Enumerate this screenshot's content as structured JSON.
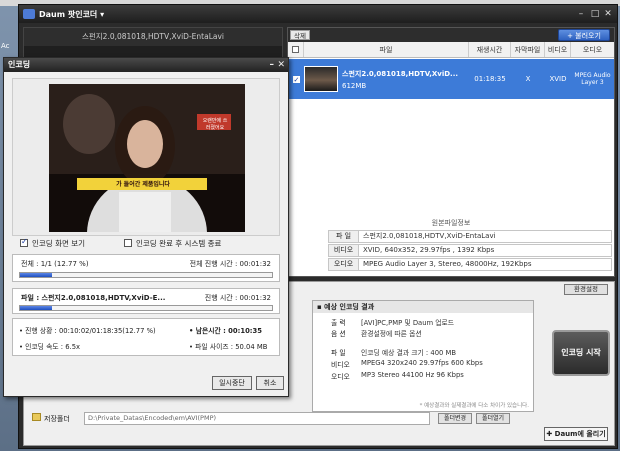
{
  "desktop": {
    "side_label": "Ac"
  },
  "main": {
    "title": "Daum 팟인코더 ▾",
    "left_header": "스펀지2.0,081018,HDTV,XviD-EntaLavi",
    "toolbar": {
      "delete_label": "삭제",
      "load_label": "+ 불러오기"
    },
    "list_headers": [
      "파일",
      "재생시간",
      "자막파일",
      "비디오",
      "오디오"
    ],
    "file": {
      "name": "스펀지2.0,081018,HDTV,XviD...",
      "size": "612MB",
      "duration": "01:18:35",
      "subtitle": "X",
      "video": "XVID",
      "audio": "MPEG Audio Layer 3"
    },
    "orig_info_title": "원본파일정보",
    "orig_info": [
      {
        "key": "파 일",
        "value": "스펀지2.0,081018,HDTV,XviD-EntaLavi"
      },
      {
        "key": "비디오",
        "value": "XVID, 640x352, 29.97fps , 1392 Kbps"
      },
      {
        "key": "오디오",
        "value": "MPEG Audio Layer 3, Stereo, 48000Hz, 192Kbps"
      }
    ]
  },
  "settings": {
    "env_label": "환경설정",
    "result_title": "▪ 예상 인코딩 결과",
    "result_rows": [
      {
        "key": "출 력",
        "value": "[AVI]PC,PMP 및 Daum 업로드"
      },
      {
        "key": "음 션",
        "value": "환경설정에 따른 옵션"
      },
      {
        "key": "파 일",
        "value": "인코딩 예상 결과 크기 : 400 MB"
      },
      {
        "key": "비디오",
        "value": "MPEG4 320x240 29.97fps  600 Kbps"
      },
      {
        "key": "오디오",
        "value": "MP3 Stereo 44100 Hz 96 Kbps"
      }
    ],
    "result_note": "* 예상결과와 실제결과에 다소 차이가 있습니다.",
    "start_label": "인코딩 시작",
    "save_label": "저장폴더",
    "save_path": "D:\\Private_Datas\\Encoded\\em\\AVI(PMP)",
    "change_label": "폴더변경",
    "open_label": "폴더열기",
    "upload_label": "✚ Daum에 올리기"
  },
  "dialog": {
    "title": "인코딩",
    "show_video_label": "인코딩 화면 보기",
    "shutdown_label": "인코딩 완료 후 시스템 종료",
    "total_label": "전체 : 1/1 (12.77 %)",
    "total_time": "전체 진행 시간 : 00:01:32",
    "total_progress": 0.1277,
    "file_label": "파일 : 스펀지2.0,081018,HDTV,XviD-E...",
    "file_time": "진행 시간 : 00:01:32",
    "file_progress": 0.1277,
    "status": "• 진행 상황 : 00:10:02/01:18:35(12.77 %)",
    "remaining": "• 남은시간 : 00:10:35",
    "speed": "• 인코딩 속도 : 6.5x",
    "filesize": "• 파일 사이즈 : 50.04 MB",
    "pause_label": "일시중단",
    "cancel_label": "취소",
    "caption_top": "오랜만에 쓰러졌어요",
    "caption_main": "가 들어간 제품입니다"
  }
}
